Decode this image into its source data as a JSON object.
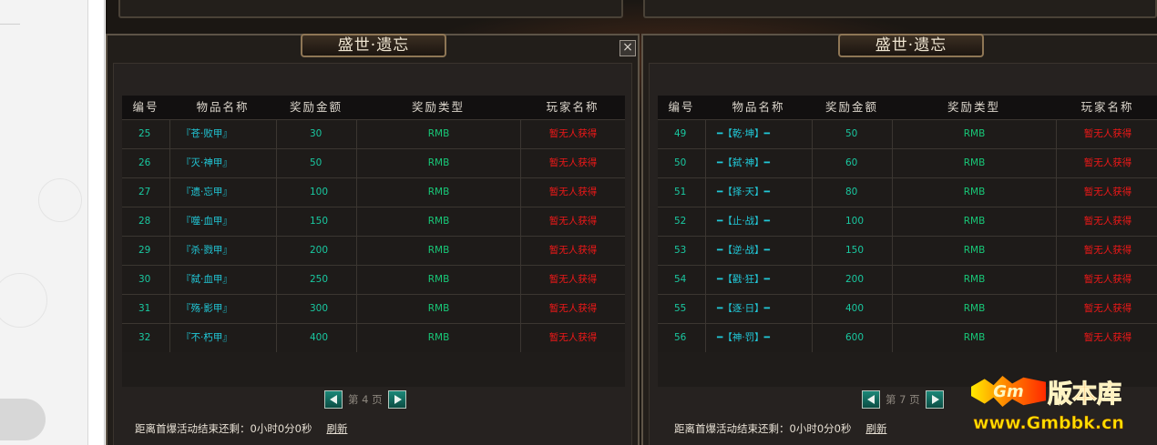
{
  "colors": {
    "frame": "#5d5447",
    "panel_bg": "#221e1a",
    "header_text": "#dcd6cc",
    "number_text": "#19c8a0",
    "item_text": "#21c8d8",
    "type_text": "#18c878",
    "player_text": "#f01818"
  },
  "icons": {
    "close": "close-icon",
    "prev": "arrow-left-icon",
    "next": "arrow-right-icon"
  },
  "panels": [
    {
      "title": "盛世·遗忘",
      "close_label": "×",
      "headers": [
        "编号",
        "物品名称",
        "奖励金额",
        "奖励类型",
        "玩家名称"
      ],
      "rows": [
        [
          "25",
          "『苍·败甲』",
          "30",
          "RMB",
          "暂无人获得"
        ],
        [
          "26",
          "『灭·神甲』",
          "50",
          "RMB",
          "暂无人获得"
        ],
        [
          "27",
          "『遗·忘甲』",
          "100",
          "RMB",
          "暂无人获得"
        ],
        [
          "28",
          "『噬·血甲』",
          "150",
          "RMB",
          "暂无人获得"
        ],
        [
          "29",
          "『杀·戮甲』",
          "200",
          "RMB",
          "暂无人获得"
        ],
        [
          "30",
          "『弑·血甲』",
          "250",
          "RMB",
          "暂无人获得"
        ],
        [
          "31",
          "『殇·影甲』",
          "300",
          "RMB",
          "暂无人获得"
        ],
        [
          "32",
          "『不·朽甲』",
          "400",
          "RMB",
          "暂无人获得"
        ]
      ],
      "page_label": "第 4 页",
      "countdown": "距离首爆活动结束还剩：0小时0分0秒",
      "refresh_label": "刷新"
    },
    {
      "title": "盛世·遗忘",
      "headers": [
        "编号",
        "物品名称",
        "奖励金额",
        "奖励类型",
        "玩家名称"
      ],
      "rows": [
        [
          "49",
          "━【乾·坤】━",
          "50",
          "RMB",
          "暂无人获得"
        ],
        [
          "50",
          "━【弑·神】━",
          "60",
          "RMB",
          "暂无人获得"
        ],
        [
          "51",
          "━【择·天】━",
          "80",
          "RMB",
          "暂无人获得"
        ],
        [
          "52",
          "━【止·战】━",
          "100",
          "RMB",
          "暂无人获得"
        ],
        [
          "53",
          "━【逆·战】━",
          "150",
          "RMB",
          "暂无人获得"
        ],
        [
          "54",
          "━【戳·狂】━",
          "200",
          "RMB",
          "暂无人获得"
        ],
        [
          "55",
          "━【逐·日】━",
          "400",
          "RMB",
          "暂无人获得"
        ],
        [
          "56",
          "━【神·罚】━",
          "600",
          "RMB",
          "暂无人获得"
        ]
      ],
      "page_label": "第 7 页",
      "countdown": "距离首爆活动结束还剩：0小时0分0秒",
      "refresh_label": "刷新"
    }
  ],
  "watermark": {
    "logo_text": "Gm",
    "cn_text": "版本库",
    "url": "www.Gmbbk.cn"
  }
}
